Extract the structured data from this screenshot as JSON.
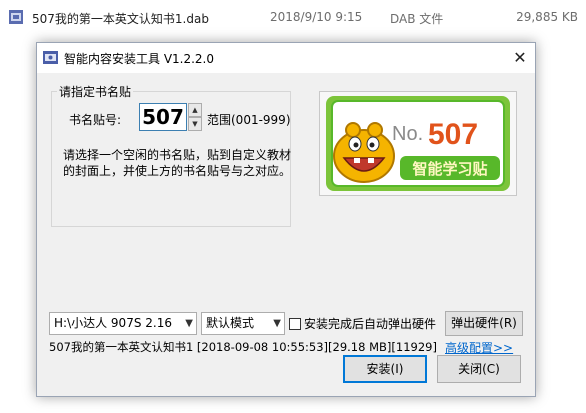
{
  "file_row": {
    "name": "507我的第一本英文认知书1.dab",
    "date": "2018/9/10 9:15",
    "type": "DAB 文件",
    "size": "29,885 KB"
  },
  "dialog": {
    "title": "智能内容安装工具 V1.2.2.0",
    "close_glyph": "✕",
    "group_title": "请指定书名贴",
    "book_label": "书名贴号:",
    "book_number": "507",
    "range_text": "范围(001-999)",
    "description_lines": [
      "请选择一个空闲的书名贴，贴到自定义教材",
      "的封面上，并使上方的书名贴号与之对应。"
    ],
    "logo": {
      "no_text": "No.",
      "number": "507",
      "caption": "智能学习贴"
    },
    "device_select": "H:\\小达人 907S 2.16",
    "mode_select": "默认模式",
    "auto_eject_label": "安装完成后自动弹出硬件",
    "auto_eject_checked": false,
    "eject_button": "弹出硬件(R)",
    "file_info": "507我的第一本英文认知书1 [2018-09-08 10:55:53][29.18 MB][11929]",
    "advanced_link": "高级配置>>",
    "install_button": "安装(I)",
    "close_button": "关闭(C)"
  },
  "colors": {
    "accent_blue": "#0078d7",
    "logo_green": "#58b82a",
    "logo_number_orange": "#e1531b"
  }
}
